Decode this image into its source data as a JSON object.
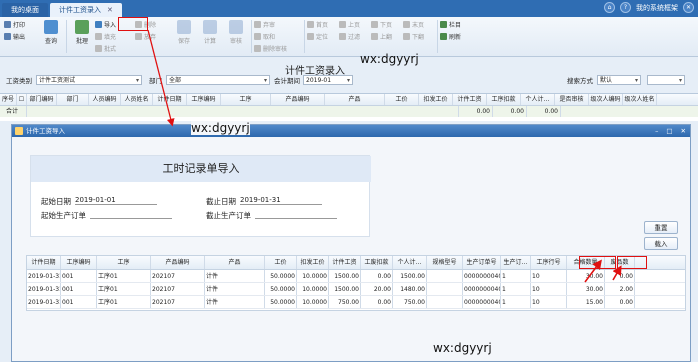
{
  "tabs": [
    {
      "label": "我的桌面"
    },
    {
      "label": "计件工资录入"
    }
  ],
  "window_ctl": {
    "search_label": "我的系统框架",
    "a": "⌂",
    "b": "?",
    "c": "✕"
  },
  "ribbon": {
    "print": "打印",
    "output": "输出",
    "query": "查询",
    "batch": "批理",
    "import": "导入",
    "fill": "填充",
    "bulk": "批式",
    "del": "删除",
    "release": "放弃",
    "save": "保存",
    "calc": "计算",
    "audit": "审核",
    "review": "弃审",
    "sum": "取和",
    "cancel_audit": "删除审核",
    "firstpage": "首页",
    "uppage": "上页",
    "downpage": "下页",
    "lastpage": "末页",
    "col": "栏目",
    "refresh": "刷新",
    "loc": "定位",
    "filter": "过滤",
    "prevrec": "上翻",
    "nextrec": "下翻",
    "a1": "增行",
    "a2": "删行"
  },
  "page_title": "计件工资录入",
  "watermark": "wx:dgyyrj",
  "filter": {
    "type_label": "工资类别",
    "type_value": "计件工资测试",
    "dept_label": "部门",
    "dept_value": "全部",
    "period_label": "会计期间",
    "period_value": "2019-01",
    "search_label": "搜索方式",
    "search_value": "默认"
  },
  "main_grid": {
    "headers": [
      "序号",
      "",
      "部门编码",
      "部门",
      "人员编码",
      "人员姓名",
      "计件日期",
      "工序编码",
      "工序",
      "产品编码",
      "产品",
      "工价",
      "扣发工价",
      "计件工资",
      "工序扣款",
      "个人计…",
      "是否审核",
      "级次人编码",
      "级次人姓名"
    ],
    "total_label": "合计",
    "totals": [
      "0.00",
      "0.00",
      "0.00"
    ]
  },
  "dialog": {
    "title": "计件工资导入",
    "heading": "工时记录单导入",
    "start_label": "起始日期",
    "start_value": "2019-01-01",
    "end_label": "截止日期",
    "end_value": "2019-01-31",
    "start_order_label": "起始生产订单",
    "end_order_label": "截止生产订单",
    "reset": "重置",
    "load": "载入",
    "headers": [
      "计件日期",
      "工序编码",
      "工序",
      "产品编码",
      "产品",
      "工价",
      "扣发工价",
      "计件工资",
      "工废扣款",
      "个人计…",
      "规格型号",
      "生产订单号",
      "生产订…",
      "工序行号",
      "合格数量",
      "废品数"
    ],
    "rows": [
      [
        "2019-01-31",
        "001",
        "工序01",
        "202107",
        "计件",
        "50.0000",
        "10.0000",
        "1500.00",
        "0.00",
        "1500.00",
        "",
        "0000000040",
        "1",
        "10",
        "30.00",
        "0.00"
      ],
      [
        "2019-01-31",
        "001",
        "工序01",
        "202107",
        "计件",
        "50.0000",
        "10.0000",
        "1500.00",
        "20.00",
        "1480.00",
        "",
        "0000000040",
        "1",
        "10",
        "30.00",
        "2.00"
      ],
      [
        "2019-01-31",
        "001",
        "工序01",
        "202107",
        "计件",
        "50.0000",
        "10.0000",
        "750.00",
        "0.00",
        "750.00",
        "",
        "0000000040",
        "1",
        "10",
        "15.00",
        "0.00"
      ]
    ]
  },
  "colors": {
    "accent": "#2f6db3",
    "highlight": "#e01010"
  }
}
